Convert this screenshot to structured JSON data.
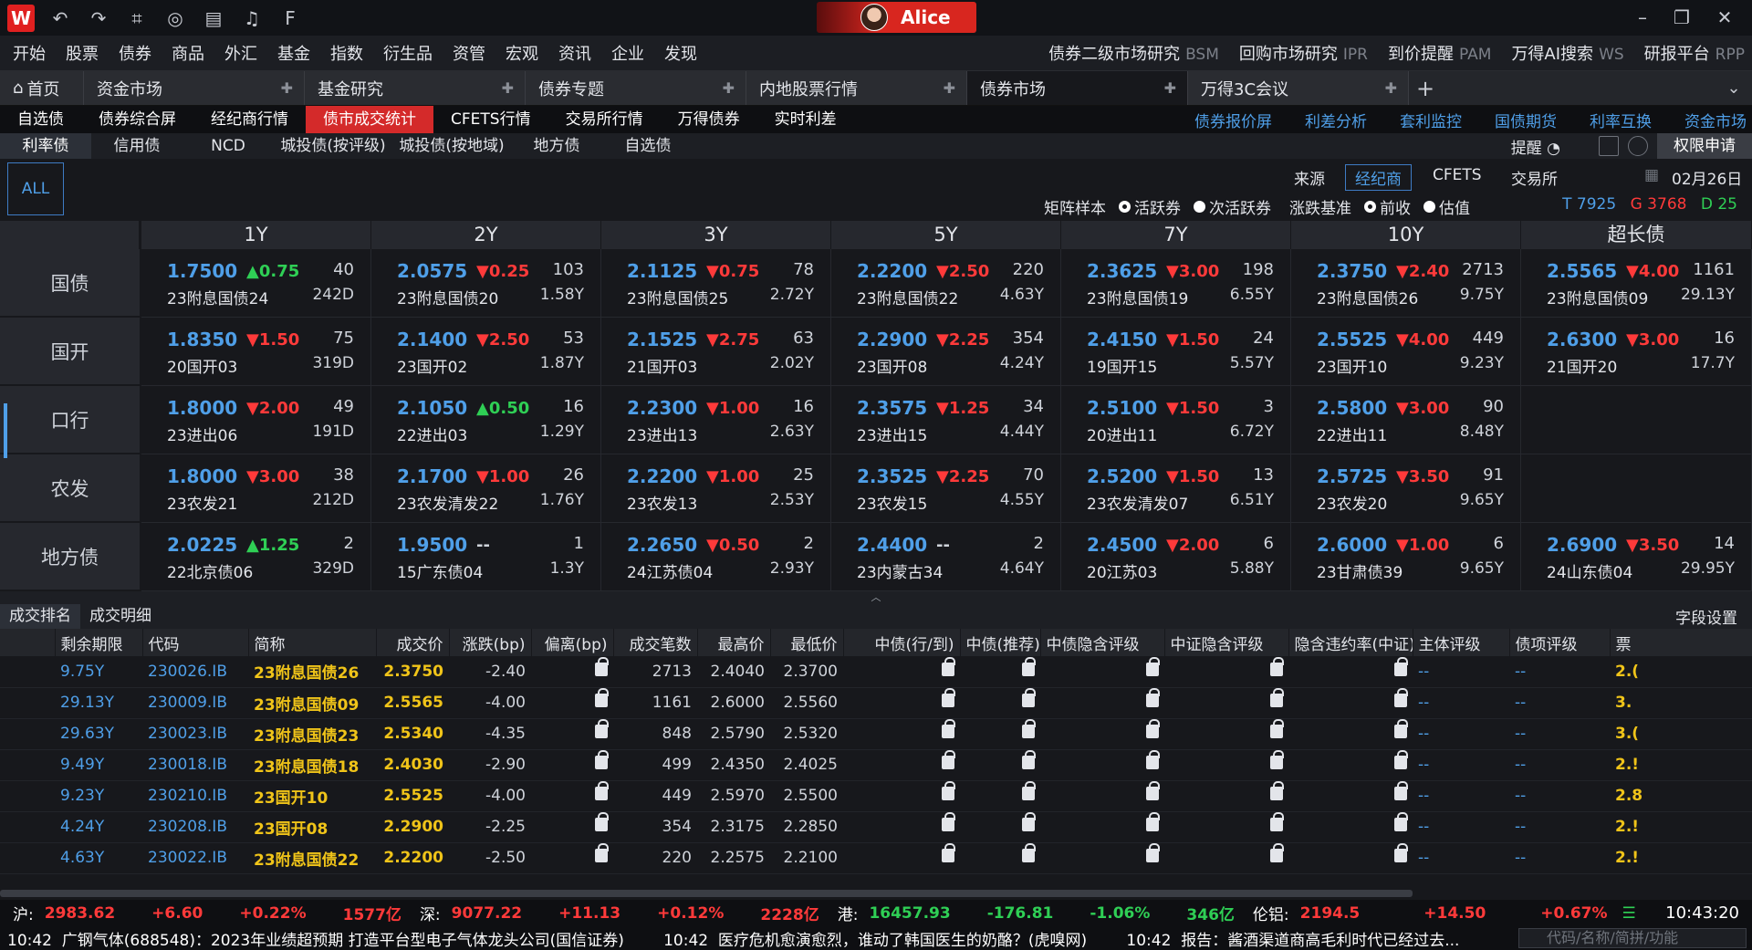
{
  "window": {
    "logo": "W",
    "user": "Alice"
  },
  "menu": {
    "left": [
      "开始",
      "股票",
      "债券",
      "商品",
      "外汇",
      "基金",
      "指数",
      "衍生品",
      "资管",
      "宏观",
      "资讯",
      "企业",
      "发现"
    ],
    "right": [
      {
        "label": "债券二级市场研究",
        "code": "BSM"
      },
      {
        "label": "回购市场研究",
        "code": "IPR"
      },
      {
        "label": "到价提醒",
        "code": "PAM"
      },
      {
        "label": "万得AI搜索",
        "code": "WS"
      },
      {
        "label": "研报平台",
        "code": "RPP"
      }
    ]
  },
  "doc_tabs": {
    "home": "首页",
    "tabs": [
      "资金市场",
      "基金研究",
      "债券专题",
      "内地股票行情",
      "债券市场",
      "万得3C会议"
    ]
  },
  "subnav": {
    "left": [
      "自选债",
      "债券综合屏",
      "经纪商行情",
      "债市成交统计",
      "CFETS行情",
      "交易所行情",
      "万得债券",
      "实时利差"
    ],
    "active": 3,
    "right": [
      "债券报价屏",
      "利差分析",
      "套利监控",
      "国债期货",
      "利率互换",
      "资金市场"
    ]
  },
  "categories": {
    "items": [
      "利率债",
      "信用债",
      "NCD",
      "城投债(按评级)",
      "城投债(按地域)",
      "地方债",
      "自选债"
    ],
    "remind": "提醒",
    "permission": "权限申请"
  },
  "filter": {
    "all": "ALL",
    "sources": [
      "来源",
      "经纪商",
      "CFETS",
      "交易所"
    ],
    "date": "02月26日",
    "matrix_sample": "矩阵样本",
    "active_bond": "活跃券",
    "sub_active": "次活跃券",
    "base": "涨跌基准",
    "prev_close": "前收",
    "valuation": "估值",
    "counts": {
      "t": "T 7925",
      "g": "G 3768",
      "d": "D 25"
    }
  },
  "matrix": {
    "columns": [
      "1Y",
      "2Y",
      "3Y",
      "5Y",
      "7Y",
      "10Y",
      "超长债"
    ],
    "rows": [
      {
        "label": "国债",
        "cells": [
          {
            "rate": "1.7500",
            "chg": "▲0.75",
            "dir": "up",
            "cnt": "40",
            "name": "23附息国债24",
            "ten": "242D"
          },
          {
            "rate": "2.0575",
            "chg": "▼0.25",
            "dir": "dn",
            "cnt": "103",
            "name": "23附息国债20",
            "ten": "1.58Y"
          },
          {
            "rate": "2.1125",
            "chg": "▼0.75",
            "dir": "dn",
            "cnt": "78",
            "name": "23附息国债25",
            "ten": "2.72Y"
          },
          {
            "rate": "2.2200",
            "chg": "▼2.50",
            "dir": "dn",
            "cnt": "220",
            "name": "23附息国债22",
            "ten": "4.63Y"
          },
          {
            "rate": "2.3625",
            "chg": "▼3.00",
            "dir": "dn",
            "cnt": "198",
            "name": "23附息国债19",
            "ten": "6.55Y"
          },
          {
            "rate": "2.3750",
            "chg": "▼2.40",
            "dir": "dn",
            "cnt": "2713",
            "name": "23附息国债26",
            "ten": "9.75Y"
          },
          {
            "rate": "2.5565",
            "chg": "▼4.00",
            "dir": "dn",
            "cnt": "1161",
            "name": "23附息国债09",
            "ten": "29.13Y"
          }
        ]
      },
      {
        "label": "国开",
        "cells": [
          {
            "rate": "1.8350",
            "chg": "▼1.50",
            "dir": "dn",
            "cnt": "75",
            "name": "20国开03",
            "ten": "319D"
          },
          {
            "rate": "2.1400",
            "chg": "▼2.50",
            "dir": "dn",
            "cnt": "53",
            "name": "23国开02",
            "ten": "1.87Y"
          },
          {
            "rate": "2.1525",
            "chg": "▼2.75",
            "dir": "dn",
            "cnt": "63",
            "name": "21国开03",
            "ten": "2.02Y"
          },
          {
            "rate": "2.2900",
            "chg": "▼2.25",
            "dir": "dn",
            "cnt": "354",
            "name": "23国开08",
            "ten": "4.24Y"
          },
          {
            "rate": "2.4150",
            "chg": "▼1.50",
            "dir": "dn",
            "cnt": "24",
            "name": "19国开15",
            "ten": "5.57Y"
          },
          {
            "rate": "2.5525",
            "chg": "▼4.00",
            "dir": "dn",
            "cnt": "449",
            "name": "23国开10",
            "ten": "9.23Y"
          },
          {
            "rate": "2.6300",
            "chg": "▼3.00",
            "dir": "dn",
            "cnt": "16",
            "name": "21国开20",
            "ten": "17.7Y"
          }
        ]
      },
      {
        "label": "口行",
        "cells": [
          {
            "rate": "1.8000",
            "chg": "▼2.00",
            "dir": "dn",
            "cnt": "49",
            "name": "23进出06",
            "ten": "191D"
          },
          {
            "rate": "2.1050",
            "chg": "▲0.50",
            "dir": "up",
            "cnt": "16",
            "name": "22进出03",
            "ten": "1.29Y"
          },
          {
            "rate": "2.2300",
            "chg": "▼1.00",
            "dir": "dn",
            "cnt": "16",
            "name": "23进出13",
            "ten": "2.63Y"
          },
          {
            "rate": "2.3575",
            "chg": "▼1.25",
            "dir": "dn",
            "cnt": "34",
            "name": "23进出15",
            "ten": "4.44Y"
          },
          {
            "rate": "2.5100",
            "chg": "▼1.50",
            "dir": "dn",
            "cnt": "3",
            "name": "20进出11",
            "ten": "6.72Y"
          },
          {
            "rate": "2.5800",
            "chg": "▼3.00",
            "dir": "dn",
            "cnt": "90",
            "name": "22进出11",
            "ten": "8.48Y"
          },
          null
        ]
      },
      {
        "label": "农发",
        "cells": [
          {
            "rate": "1.8000",
            "chg": "▼3.00",
            "dir": "dn",
            "cnt": "38",
            "name": "23农发21",
            "ten": "212D"
          },
          {
            "rate": "2.1700",
            "chg": "▼1.00",
            "dir": "dn",
            "cnt": "26",
            "name": "23农发清发22",
            "ten": "1.76Y"
          },
          {
            "rate": "2.2200",
            "chg": "▼1.00",
            "dir": "dn",
            "cnt": "25",
            "name": "23农发13",
            "ten": "2.53Y"
          },
          {
            "rate": "2.3525",
            "chg": "▼2.25",
            "dir": "dn",
            "cnt": "70",
            "name": "23农发15",
            "ten": "4.55Y"
          },
          {
            "rate": "2.5200",
            "chg": "▼1.50",
            "dir": "dn",
            "cnt": "13",
            "name": "23农发清发07",
            "ten": "6.51Y"
          },
          {
            "rate": "2.5725",
            "chg": "▼3.50",
            "dir": "dn",
            "cnt": "91",
            "name": "23农发20",
            "ten": "9.65Y"
          },
          null
        ]
      },
      {
        "label": "地方债",
        "cells": [
          {
            "rate": "2.0225",
            "chg": "▲1.25",
            "dir": "up",
            "cnt": "2",
            "name": "22北京债06",
            "ten": "329D"
          },
          {
            "rate": "1.9500",
            "chg": "--",
            "dir": "flat",
            "cnt": "1",
            "name": "15广东债04",
            "ten": "1.3Y"
          },
          {
            "rate": "2.2650",
            "chg": "▼0.50",
            "dir": "dn",
            "cnt": "2",
            "name": "24江苏债04",
            "ten": "2.93Y"
          },
          {
            "rate": "2.4400",
            "chg": "--",
            "dir": "flat",
            "cnt": "2",
            "name": "23内蒙古34",
            "ten": "4.64Y"
          },
          {
            "rate": "2.4500",
            "chg": "▼2.00",
            "dir": "dn",
            "cnt": "6",
            "name": "20江苏03",
            "ten": "5.88Y"
          },
          {
            "rate": "2.6000",
            "chg": "▼1.00",
            "dir": "dn",
            "cnt": "6",
            "name": "23甘肃债39",
            "ten": "9.65Y"
          },
          {
            "rate": "2.6900",
            "chg": "▼3.50",
            "dir": "dn",
            "cnt": "14",
            "name": "24山东债04",
            "ten": "29.95Y"
          }
        ]
      }
    ]
  },
  "bottom": {
    "tabs": [
      "成交排名",
      "成交明细"
    ],
    "field_settings": "字段设置",
    "headers": [
      "剩余期限",
      "代码",
      "简称",
      "成交价",
      "涨跌(bp)",
      "偏离(bp)",
      "成交笔数",
      "最高价",
      "最低价",
      "中债(行/到)",
      "中债(推荐)",
      "中债隐含评级",
      "中证隐含评级",
      "隐含违约率(中证)",
      "主体评级",
      "债项评级",
      "票"
    ],
    "rows": [
      [
        "9.75Y",
        "230026.IB",
        "23附息国债26",
        "2.3750",
        "-2.40",
        "2713",
        "2.4040",
        "2.3700",
        "--",
        "--",
        "2.("
      ],
      [
        "29.13Y",
        "230009.IB",
        "23附息国债09",
        "2.5565",
        "-4.00",
        "1161",
        "2.6000",
        "2.5560",
        "--",
        "--",
        "3."
      ],
      [
        "29.63Y",
        "230023.IB",
        "23附息国债23",
        "2.5340",
        "-4.35",
        "848",
        "2.5790",
        "2.5320",
        "--",
        "--",
        "3.("
      ],
      [
        "9.49Y",
        "230018.IB",
        "23附息国债18",
        "2.4030",
        "-2.90",
        "499",
        "2.4350",
        "2.4025",
        "--",
        "--",
        "2.!"
      ],
      [
        "9.23Y",
        "230210.IB",
        "23国开10",
        "2.5525",
        "-4.00",
        "449",
        "2.5970",
        "2.5500",
        "--",
        "--",
        "2.8"
      ],
      [
        "4.24Y",
        "230208.IB",
        "23国开08",
        "2.2900",
        "-2.25",
        "354",
        "2.3175",
        "2.2850",
        "--",
        "--",
        "2.!"
      ],
      [
        "4.63Y",
        "230022.IB",
        "23附息国债22",
        "2.2200",
        "-2.50",
        "220",
        "2.2575",
        "2.2100",
        "--",
        "--",
        "2.!"
      ]
    ]
  },
  "status": {
    "sh": "沪:",
    "sh_v": "2983.62",
    "sh_c": "+6.60",
    "sh_p": "+0.22%",
    "sh_a": "1577亿",
    "sz": "深:",
    "sz_v": "9077.22",
    "sz_c": "+11.13",
    "sz_p": "+0.12%",
    "sz_a": "2228亿",
    "hk": "港:",
    "hk_v": "16457.93",
    "hk_c": "-176.81",
    "hk_p": "-1.06%",
    "hk_a": "346亿",
    "lme": "伦铝:",
    "lme_v": "2194.5",
    "lme_c": "+14.50",
    "lme_p": "+0.67%",
    "clock": "10:43:20"
  },
  "ticker": "10:42  广钢气体(688548)：2023年业绩超预期 打造平台型电子气体龙头公司(国信证券)        10:42  医疗危机愈演愈烈，谁动了韩国医生的奶酪？(虎嗅网)        10:42  报告：酱酒渠道商高毛利时代已经过去...",
  "search_placeholder": "代码/名称/简拼/功能"
}
